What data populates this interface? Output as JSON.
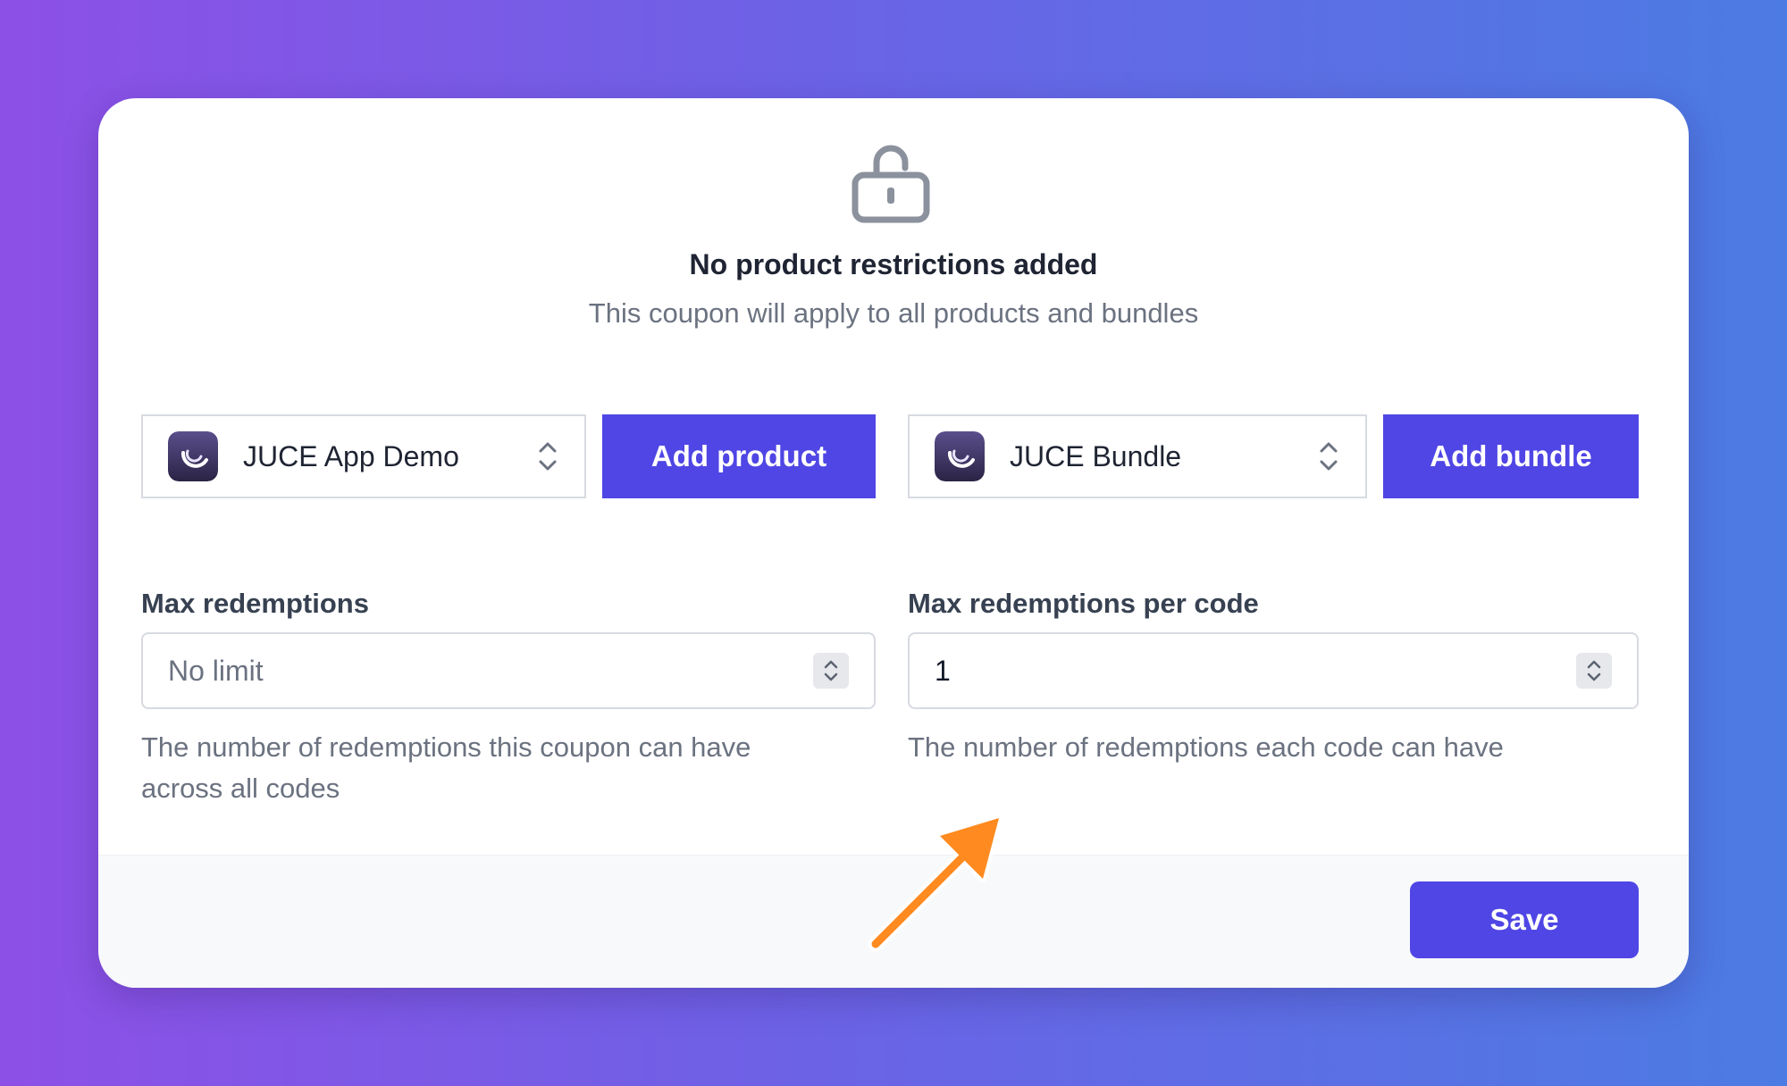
{
  "empty_state": {
    "icon": "unlock-icon",
    "title": "No product restrictions added",
    "subtitle": "This coupon will apply to all products and bundles"
  },
  "product_select": {
    "value": "JUCE App Demo",
    "icon": "juce-app-icon"
  },
  "add_product_button": "Add product",
  "bundle_select": {
    "value": "JUCE Bundle",
    "icon": "juce-app-icon"
  },
  "add_bundle_button": "Add bundle",
  "max_redemptions": {
    "label": "Max redemptions",
    "value": "No limit",
    "help": "The number of redemptions this coupon can have across all codes"
  },
  "max_redemptions_per_code": {
    "label": "Max redemptions per code",
    "value": "1",
    "help": "The number of redemptions each code can have"
  },
  "save_button": "Save",
  "colors": {
    "primary": "#4f46e5",
    "annotation_arrow": "#ff8a1f",
    "background_start": "#8d50e6",
    "background_end": "#4c7be3"
  }
}
